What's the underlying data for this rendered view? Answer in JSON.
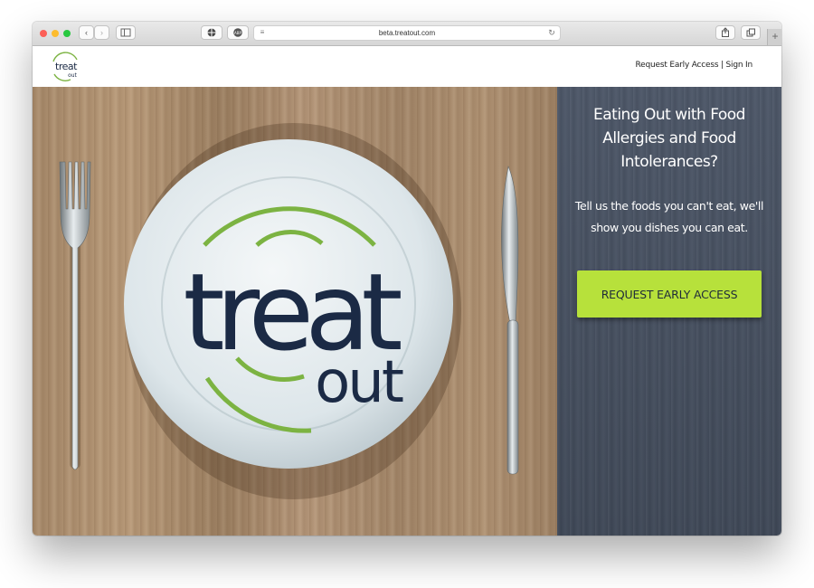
{
  "browser": {
    "url": "beta.treatout.com",
    "new_tab_label": "+"
  },
  "site": {
    "logo": {
      "line1": "treat",
      "line2": "out"
    },
    "nav": {
      "request_label": "Request Early Access",
      "separator": "|",
      "signin_label": "Sign In"
    }
  },
  "hero": {
    "plate_logo": {
      "word_top": "treat",
      "word_bottom": "out"
    }
  },
  "panel": {
    "title_lines": [
      "Eating Out with Food",
      "Allergies and Food",
      "Intolerances?"
    ],
    "subtitle_lines": [
      "Tell us the foods you can't eat, we'll",
      "show you dishes you can eat."
    ],
    "cta_label": "REQUEST EARLY ACCESS"
  },
  "colors": {
    "brand_green": "#7cb342",
    "brand_navy": "#1b2a45",
    "cta_green": "#b7e13b",
    "panel_slate": "#4a5365"
  }
}
